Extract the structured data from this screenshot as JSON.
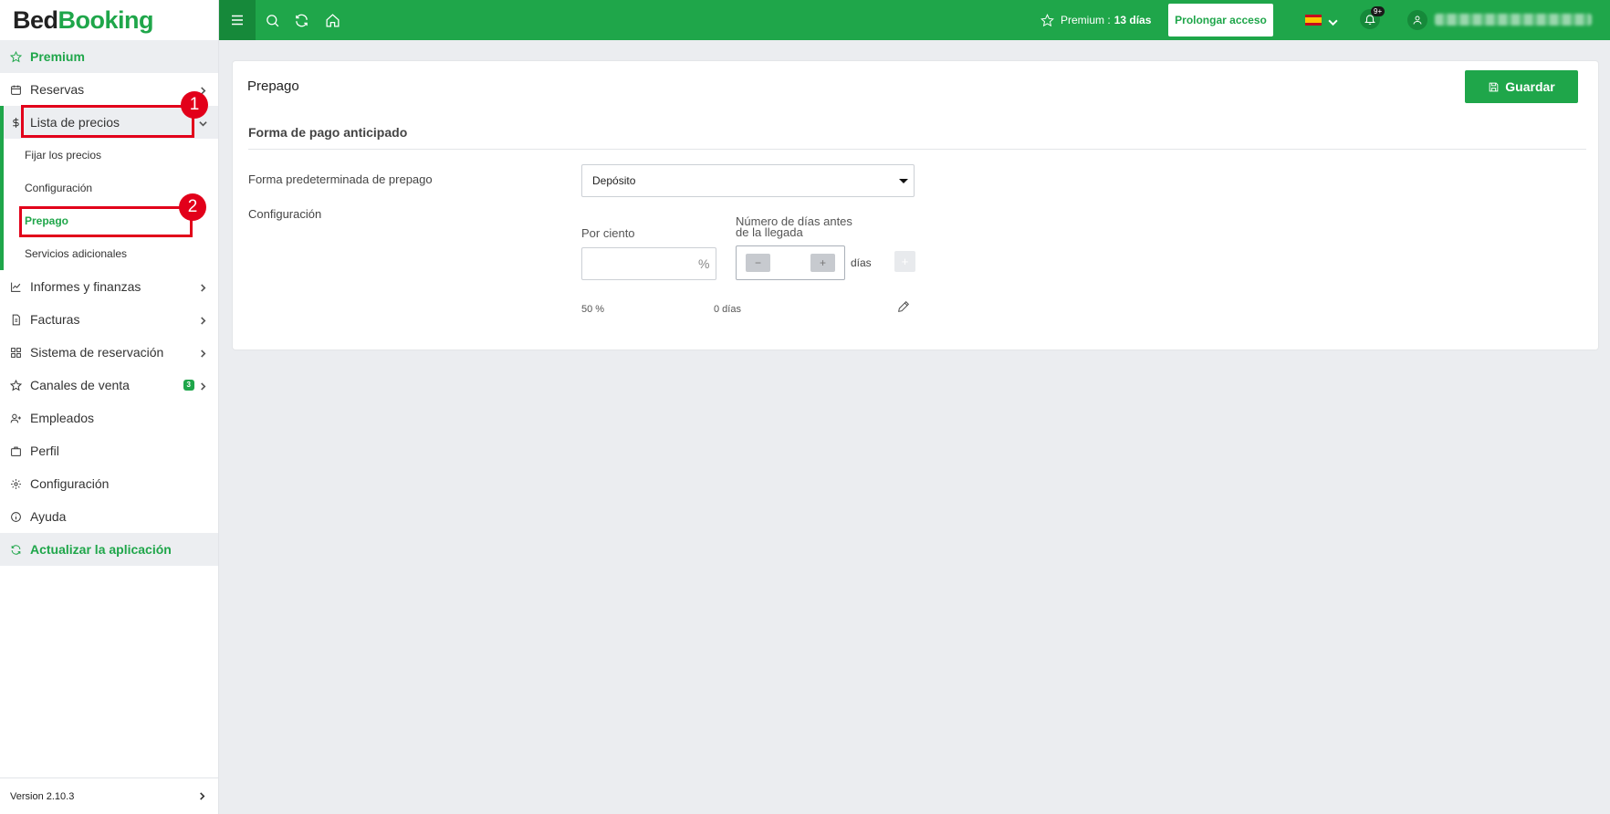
{
  "brand": {
    "part1": "Bed",
    "part2": "Booking"
  },
  "sidebar": {
    "premium": "Premium",
    "items": [
      {
        "label": "Reservas"
      },
      {
        "label": "Lista de precios"
      },
      {
        "label": "Informes y finanzas"
      },
      {
        "label": "Facturas"
      },
      {
        "label": "Sistema de reservación"
      },
      {
        "label": "Canales de venta",
        "badge": "3"
      },
      {
        "label": "Empleados"
      },
      {
        "label": "Perfil"
      },
      {
        "label": "Configuración"
      },
      {
        "label": "Ayuda"
      }
    ],
    "subitems": [
      {
        "label": "Fijar los precios"
      },
      {
        "label": "Configuración"
      },
      {
        "label": "Prepago"
      },
      {
        "label": "Servicios adicionales"
      }
    ],
    "update": "Actualizar la aplicación",
    "version": "Version 2.10.3"
  },
  "annotations": {
    "one": "1",
    "two": "2"
  },
  "topbar": {
    "premium_label": "Premium :",
    "premium_days": "13 días",
    "prolong": "Prolongar acceso",
    "notif_badge": "9+"
  },
  "page": {
    "title": "Prepago",
    "save": "Guardar",
    "section": "Forma de pago anticipado",
    "default_label": "Forma predeterminada de prepago",
    "default_value": "Depósito",
    "config_label": "Configuración",
    "percent_label": "Por ciento",
    "percent_sign": "%",
    "days_label_1": "Número de días antes",
    "days_label_2": "de la llegada",
    "minus": "−",
    "plus": "+",
    "days_suffix": "días",
    "add": "+",
    "row_percent": "50 %",
    "row_days": "0 días"
  },
  "colors": {
    "accent": "#1fa64a",
    "annotation": "#e2001a"
  }
}
